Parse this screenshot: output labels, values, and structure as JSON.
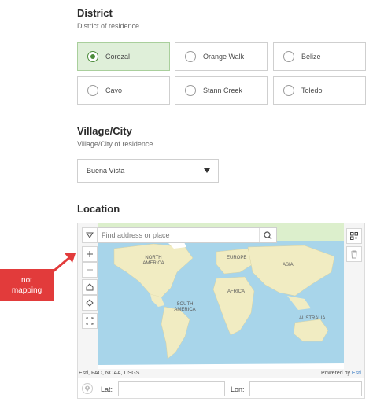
{
  "district": {
    "title": "District",
    "subtitle": "District of residence",
    "options": [
      {
        "label": "Corozal",
        "selected": true
      },
      {
        "label": "Orange Walk",
        "selected": false
      },
      {
        "label": "Belize",
        "selected": false
      },
      {
        "label": "Cayo",
        "selected": false
      },
      {
        "label": "Stann Creek",
        "selected": false
      },
      {
        "label": "Toledo",
        "selected": false
      }
    ]
  },
  "village": {
    "title": "Village/City",
    "subtitle": "Village/City of residence",
    "selected_value": "Buena Vista"
  },
  "location": {
    "title": "Location",
    "search_placeholder": "Find address or place",
    "map_labels": {
      "north_america": "NORTH AMERICA",
      "europe": "EUROPE",
      "asia": "ASIA",
      "africa": "AFRICA",
      "south_america": "SOUTH AMERICA",
      "australia": "AUSTRALIA"
    },
    "attribution_left": "Esri, FAO, NOAA, USGS",
    "attribution_powered": "Powered by ",
    "attribution_brand": "Esri",
    "lat_label": "Lat:",
    "lon_label": "Lon:",
    "lat_value": "",
    "lon_value": ""
  },
  "annotation": {
    "line1": "not",
    "line2": "mapping"
  },
  "colors": {
    "selected_bg": "#dfefd9",
    "selected_radio": "#4c8c3b",
    "callout": "#e23b3b",
    "ocean": "#a8d5ea",
    "land": "#f1ecc2"
  }
}
